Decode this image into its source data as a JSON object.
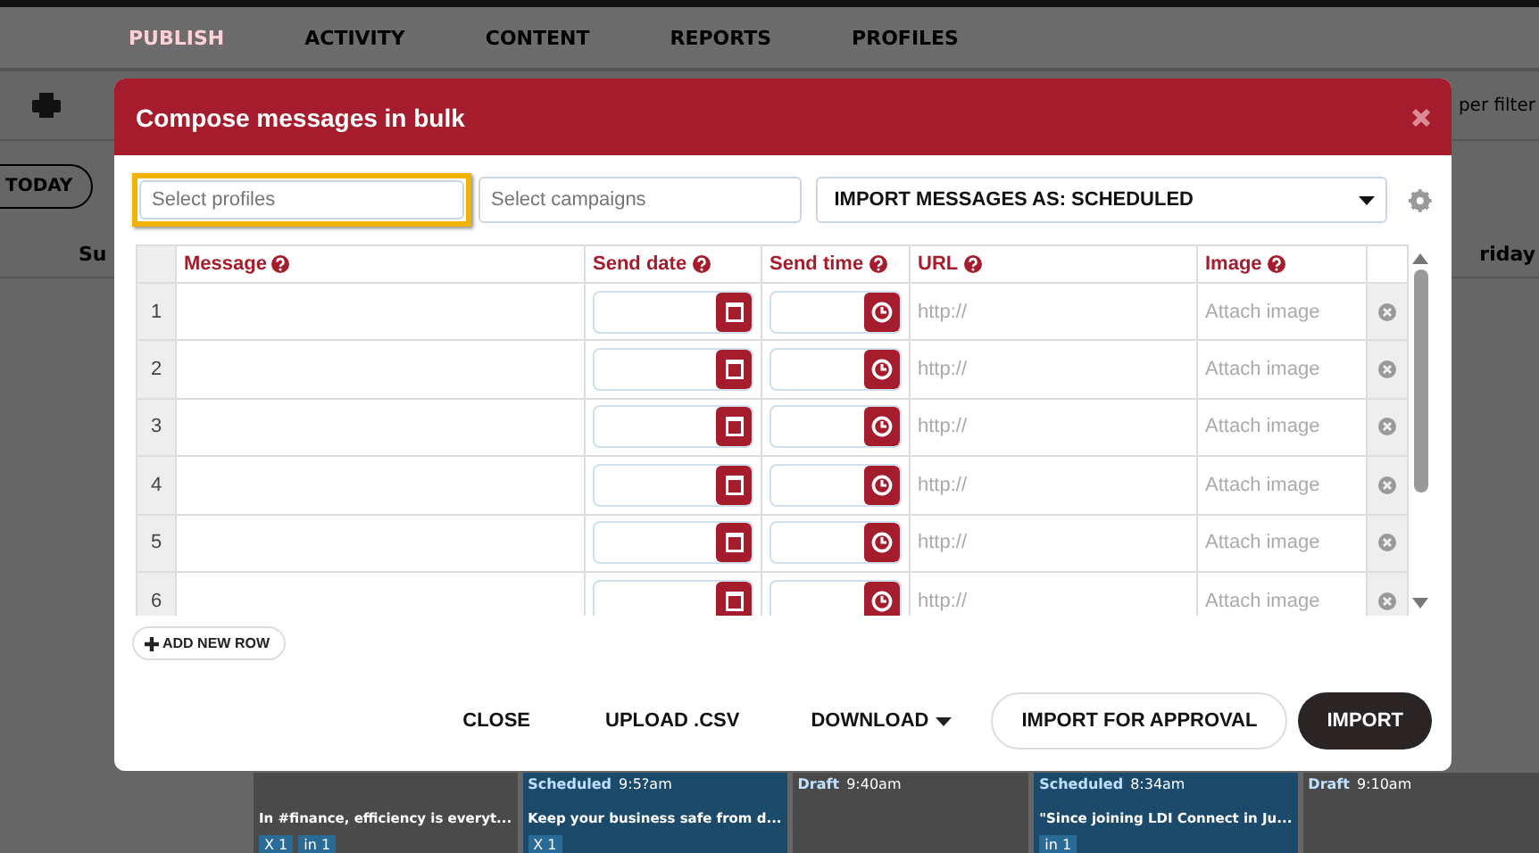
{
  "nav": {
    "tabs": [
      {
        "label": "PUBLISH",
        "selected": true
      },
      {
        "label": "ACTIVITY",
        "selected": false
      },
      {
        "label": "CONTENT",
        "selected": false
      },
      {
        "label": "REPORTS",
        "selected": false
      },
      {
        "label": "PROFILES",
        "selected": false
      }
    ]
  },
  "toolbar": {
    "filter": "per filter",
    "today": "TODAY"
  },
  "calendar": {
    "days": [
      "Su",
      "riday"
    ],
    "cards": [
      {
        "text": "In #finance, efficiency is everyt...",
        "networks": [
          "X 1",
          "in 1"
        ],
        "color": "#4a4a4a"
      },
      {
        "status": "Scheduled",
        "time": "9:5?am",
        "text": "Keep your business safe from d...",
        "networks": [
          "X 1"
        ],
        "color": "#1b4a6b"
      },
      {
        "status": "Draft",
        "time": "9:40am",
        "color": "#4a4a4a"
      },
      {
        "status": "Scheduled",
        "time": "8:34am",
        "text": "\"Since joining LDI Connect in Ju...",
        "networks": [
          "in 1"
        ],
        "color": "#1b4a6b"
      },
      {
        "status": "Draft",
        "time": "9:10am",
        "color": "#4a4a4a"
      }
    ]
  },
  "dialog": {
    "title": "Compose messages in bulk",
    "profiles": {
      "placeholder": "Select profiles"
    },
    "campaigns": {
      "placeholder": "Select campaigns"
    },
    "import_as": "IMPORT MESSAGES AS: SCHEDULED",
    "columns": [
      "Message",
      "Send date",
      "Send time",
      "URL",
      "Image"
    ],
    "rows": [
      {
        "number": "1",
        "url": "http://",
        "image": "Attach image"
      },
      {
        "number": "2",
        "url": "http://",
        "image": "Attach image"
      },
      {
        "number": "3",
        "url": "http://",
        "image": "Attach image"
      },
      {
        "number": "4",
        "url": "http://",
        "image": "Attach image"
      },
      {
        "number": "5",
        "url": "http://",
        "image": "Attach image"
      },
      {
        "number": "6",
        "url": "http://",
        "image": "Attach image"
      }
    ],
    "add_row": "ADD NEW ROW",
    "buttons": [
      {
        "label": "CLOSE",
        "kind": "text"
      },
      {
        "label": "UPLOAD .CSV",
        "kind": "text"
      },
      {
        "label": "DOWNLOAD",
        "kind": "dropdown"
      },
      {
        "label": "IMPORT FOR APPROVAL",
        "kind": "outline"
      },
      {
        "label": "IMPORT",
        "kind": "primary"
      }
    ]
  }
}
